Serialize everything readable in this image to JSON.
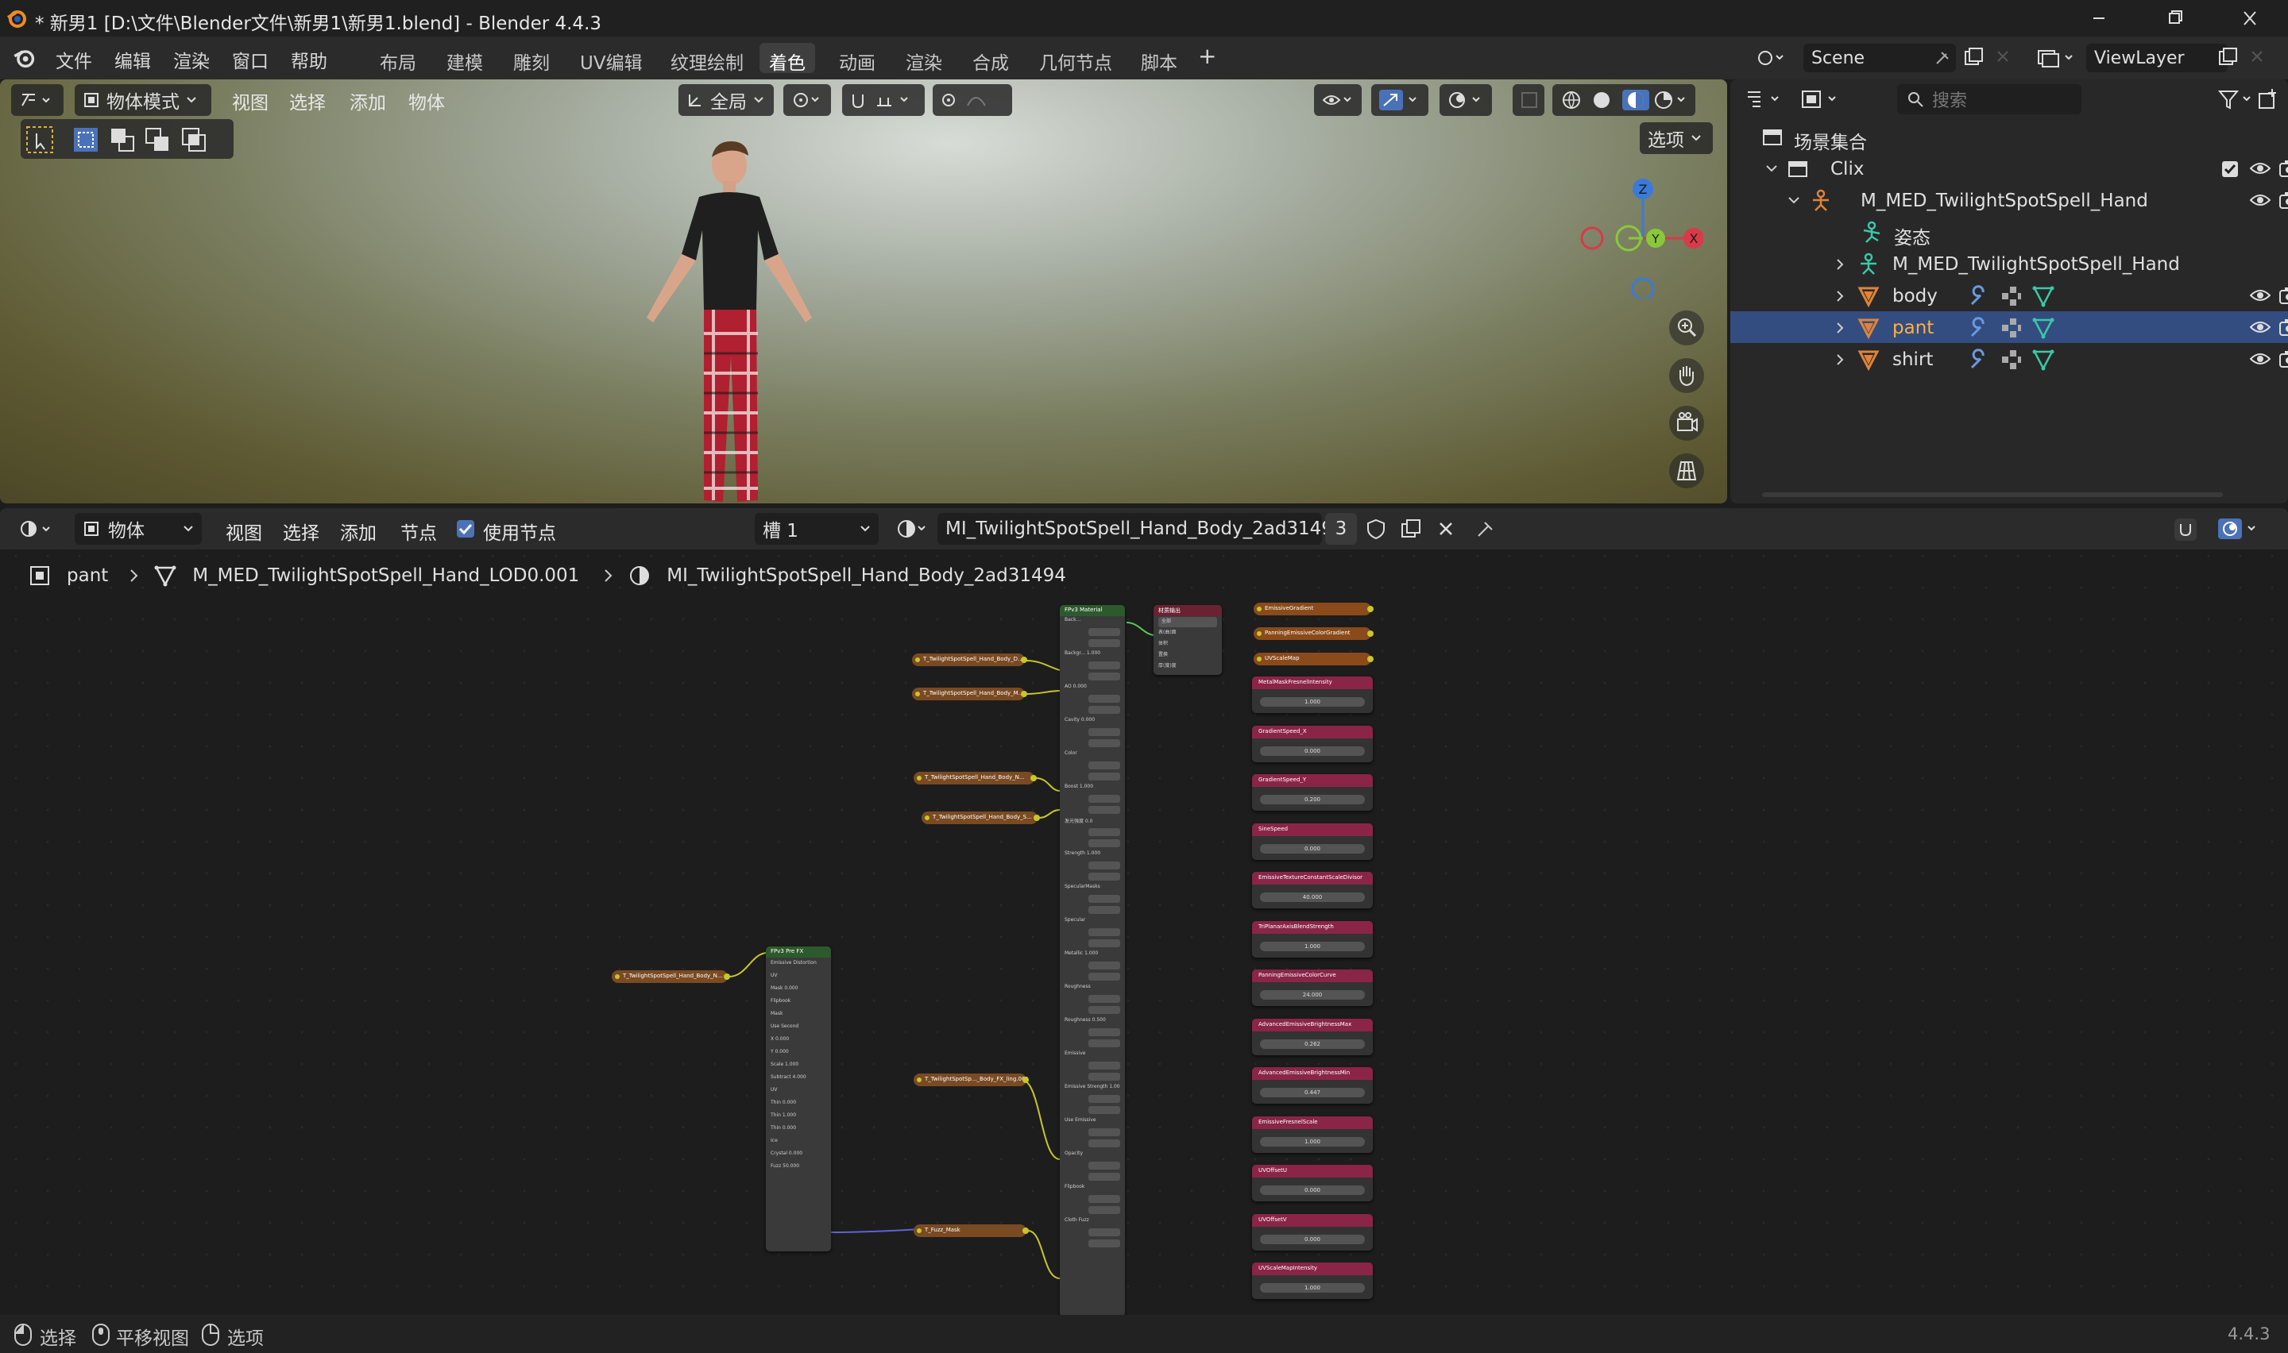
{
  "title": "* 新男1 [D:\\文件\\Blender文件\\新男1\\新男1.blend] - Blender 4.4.3",
  "menus": [
    "文件",
    "编辑",
    "渲染",
    "窗口",
    "帮助"
  ],
  "workspaces": [
    "布局",
    "建模",
    "雕刻",
    "UV编辑",
    "纹理绘制",
    "着色",
    "动画",
    "渲染",
    "合成",
    "几何节点",
    "脚本"
  ],
  "active_workspace": "着色",
  "scene_name": "Scene",
  "view_layer": "ViewLayer",
  "viewport": {
    "mode": "物体模式",
    "menus": [
      "视图",
      "选择",
      "添加",
      "物体"
    ],
    "transform_orientation": "全局",
    "options_label": "选项",
    "gizmo": {
      "z": "Z",
      "y": "Y",
      "x": "X"
    }
  },
  "outliner": {
    "search_placeholder": "搜索",
    "collection_root": "场景集合",
    "rows": [
      {
        "label": "Clix",
        "type": "collection"
      },
      {
        "label": "M_MED_TwilightSpotSpell_Hand",
        "type": "armature"
      },
      {
        "label": "姿态",
        "type": "pose"
      },
      {
        "label": "M_MED_TwilightSpotSpell_Hand",
        "type": "armature-data"
      },
      {
        "label": "body",
        "type": "mesh"
      },
      {
        "label": "pant",
        "type": "mesh",
        "selected": true
      },
      {
        "label": "shirt",
        "type": "mesh"
      }
    ]
  },
  "node_editor": {
    "type": "物体",
    "menus": [
      "视图",
      "选择",
      "添加",
      "节点"
    ],
    "use_nodes_label": "使用节点",
    "slot": "槽 1",
    "material": "MI_TwilightSpotSpell_Hand_Body_2ad31494",
    "users": "3",
    "breadcrumb": [
      "pant",
      "M_MED_TwilightSpotSpell_Hand_LOD0.001",
      "MI_TwilightSpotSpell_Hand_Body_2ad31494"
    ],
    "main_node_title": "FPv3 Material",
    "output_node_title": "材质输出",
    "output_target": "全部",
    "output_sockets": [
      "表(曲)面",
      "体积",
      "置换",
      "厚(度)度"
    ],
    "fx_node_title": "FPv3 Pre FX",
    "main_rows": [
      "Back...",
      "Backgr... 1.000",
      "AO 0.000",
      "Cavity 0.000",
      "Color",
      "Boost 1.000",
      "发光强度 0.0",
      "Strength 1.000",
      "SpecularMasks",
      "Specular",
      "Metallic 1.000",
      "Roughness",
      "Roughness 0.500",
      "Emissive",
      "Emissive Strength 1.000",
      "Use Emissive",
      "Opacity",
      "Flipbook",
      "Cloth Fuzz"
    ],
    "fx_rows": [
      "Emissive Distortion",
      "UV",
      "Mask 0.000",
      "Flipbook",
      "Mask",
      "Use Second",
      "X 0.000",
      "Y 0.000",
      "Scale 1.000",
      "Subtract 4.000",
      "UV",
      "Thin 0.000",
      "Thin 1.000",
      "Thin 0.000",
      "Ice",
      "Crystal 0.000",
      "Fuzz 50.000"
    ],
    "texture_nodes": [
      "T_TwilightSpotSpell_Hand_Body_D...",
      "T_TwilightSpotSpell_Hand_Body_M...",
      "T_TwilightSpotSpell_Hand_Body_N...",
      "T_TwilightSpotSpell_Hand_Body_S...",
      "T_TwilightSpotSpell_Hand_Body_N...",
      "T_TwilightSpotSp..._Body_FX_ling.001",
      "T_Fuzz_Mask"
    ],
    "orange_params": [
      "EmissiveGradient",
      "PanningEmissiveColorGradient",
      "UVScaleMap"
    ],
    "params": [
      {
        "name": "MetalMaskFresnelIntensity",
        "value": "1.000"
      },
      {
        "name": "GradientSpeed_X",
        "value": "0.000"
      },
      {
        "name": "GradientSpeed_Y",
        "value": "0.200"
      },
      {
        "name": "SineSpeed",
        "value": "0.000"
      },
      {
        "name": "EmissiveTextureConstantScaleDivisor",
        "value": "40.000"
      },
      {
        "name": "TriPlanarAxisBlendStrength",
        "value": "1.000"
      },
      {
        "name": "PanningEmissiveColorCurve",
        "value": "24.000"
      },
      {
        "name": "AdvancedEmissiveBrightnessMax",
        "value": "0.262"
      },
      {
        "name": "AdvancedEmissiveBrightnessMin",
        "value": "0.447"
      },
      {
        "name": "EmissiveFresnelScale",
        "value": "1.000"
      },
      {
        "name": "UVOffsetU",
        "value": "0.000"
      },
      {
        "name": "UVOffsetV",
        "value": "0.000"
      },
      {
        "name": "UVScaleMapIntensity",
        "value": "1.000"
      }
    ]
  },
  "status": {
    "select": "选择",
    "pan": "平移视图",
    "options": "选项",
    "version": "4.4.3"
  }
}
